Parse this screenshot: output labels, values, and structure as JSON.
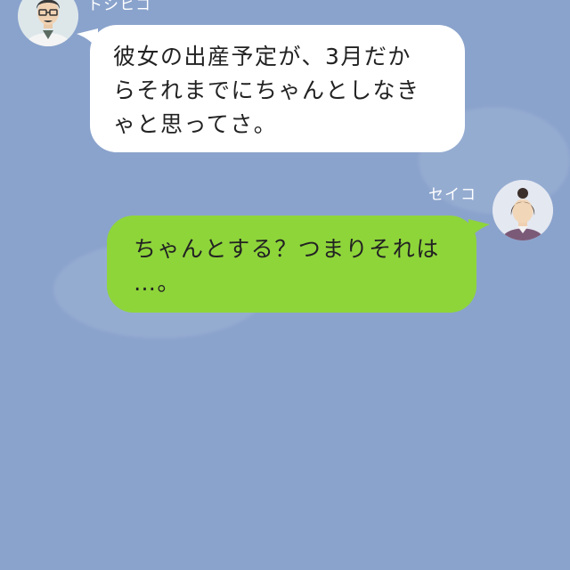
{
  "chat": {
    "messages": [
      {
        "side": "left",
        "sender": "トシヒコ",
        "avatar_icon": "man-with-glasses-avatar-icon",
        "lines": [
          "彼女の出産予定が、3月だか",
          "らそれまでにちゃんとしなき",
          "ゃと思ってさ。"
        ]
      },
      {
        "side": "right",
        "sender": "セイコ",
        "avatar_icon": "woman-with-bun-avatar-icon",
        "lines": [
          "ちゃんとする？つまりそれは",
          "…。"
        ]
      }
    ]
  },
  "colors": {
    "background": "#8aa3cc",
    "incoming_bubble": "#ffffff",
    "outgoing_bubble": "#8ed53a",
    "name_text": "#ffffff",
    "message_text": "#222222"
  }
}
